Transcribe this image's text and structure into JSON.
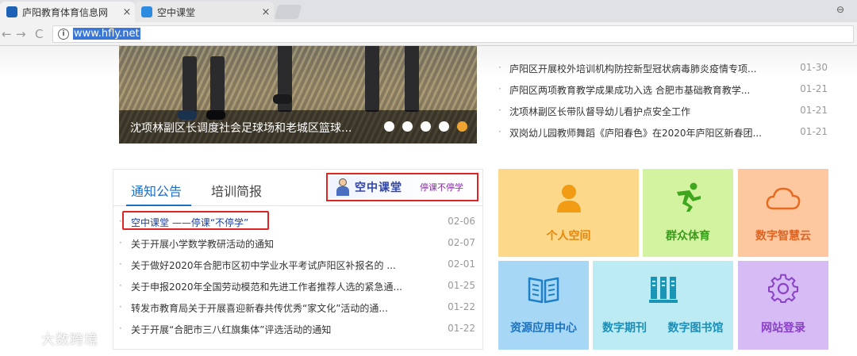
{
  "browser": {
    "tabs": [
      {
        "title": "庐阳教育体育信息网",
        "close": "×"
      },
      {
        "title": "空中课堂",
        "close": "×"
      }
    ],
    "back": "←",
    "forward": "→",
    "reload": "C",
    "info": "i",
    "url": "www.hfly.net",
    "user": "⊖"
  },
  "slider": {
    "caption": "沈项林副区长调度社会足球场和老城区篮球...",
    "dot_count": 5,
    "active_dot": 5
  },
  "news_right": {
    "items": [
      {
        "title": "庐阳区开展校外培训机构防控新型冠状病毒肺炎疫情专项...",
        "date": "01-30"
      },
      {
        "title": "庐阳区两项教育教学成果成功入选 合肥市基础教育教学...",
        "date": "01-21"
      },
      {
        "title": "沈项林副区长带队督导幼儿看护点安全工作",
        "date": "01-21"
      },
      {
        "title": "双岗幼儿园教师舞蹈《庐阳春色》在2020年庐阳区新春团...",
        "date": "01-21"
      }
    ],
    "bullet": "·"
  },
  "notice": {
    "tabs": [
      "通知公告",
      "培训简报"
    ],
    "banner_title": "空中课堂",
    "banner_sub": "停课不停学",
    "bullet": "·",
    "items": [
      {
        "title": "空中课堂 ——停课“不停学”",
        "date": "02-06"
      },
      {
        "title": "关于开展小学数学教研活动的通知",
        "date": "02-07"
      },
      {
        "title": "关于做好2020年合肥市区初中学业水平考试庐阳区补报名的 ...",
        "date": "02-01"
      },
      {
        "title": "关于申报2020年全国劳动模范和先进工作者推荐人选的紧急通...",
        "date": "01-25"
      },
      {
        "title": "转发市教育局关于开展喜迎新春共传优秀“家文化”活动的通...",
        "date": "01-22"
      },
      {
        "title": "关于开展“合肥市三八红旗集体”评选活动的通知",
        "date": "01-22"
      }
    ]
  },
  "tiles": {
    "personal": {
      "label": "个人空间",
      "icon": "person-icon",
      "bg": "#fbd88a"
    },
    "sports": {
      "label": "群众体育",
      "icon": "runner-icon",
      "bg": "#d4f3a1"
    },
    "cloud": {
      "label": "数字智慧云",
      "icon": "cloud-icon",
      "bg": "#fdc7a0"
    },
    "resource": {
      "label": "资源应用中心",
      "icon": "book-icon",
      "bg": "#a6d8f6"
    },
    "journal": {
      "label": "数字期刊",
      "icon": "books-icon",
      "bg": "#bdebf4"
    },
    "library": {
      "label": "数字图书馆"
    },
    "login": {
      "label": "网站登录",
      "icon": "gear-icon",
      "bg": "#d6bbf4"
    }
  },
  "watermark": "大数跨境"
}
